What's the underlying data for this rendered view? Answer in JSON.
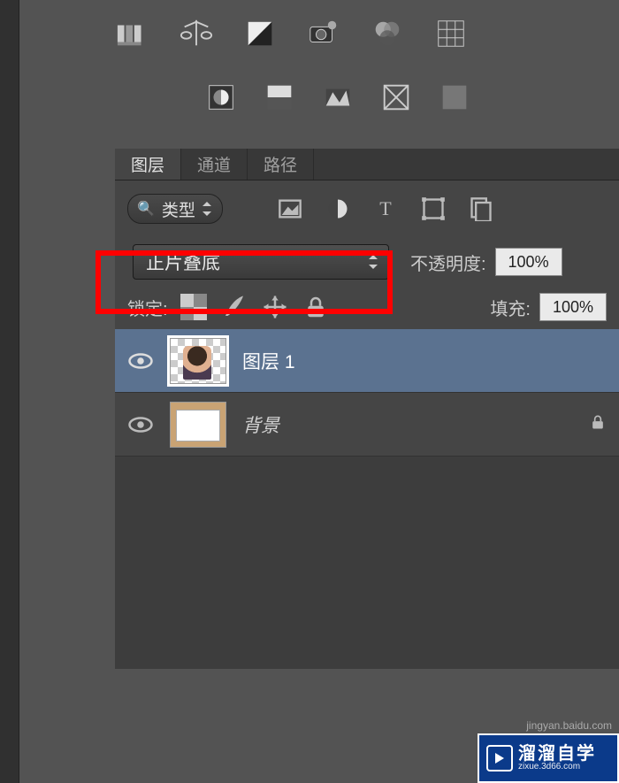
{
  "tabs": {
    "layers": "图层",
    "channels": "通道",
    "paths": "路径"
  },
  "filter": {
    "label": "类型"
  },
  "blend": {
    "mode": "正片叠底"
  },
  "opacity": {
    "label": "不透明度:",
    "value": "100%"
  },
  "lock": {
    "label": "锁定:"
  },
  "fill": {
    "label": "填充:",
    "value": "100%"
  },
  "layers_list": [
    {
      "name": "图层 1"
    },
    {
      "name": "背景"
    }
  ],
  "watermark": {
    "brand": "溜溜自学",
    "url": "zixue.3d66.com",
    "credit": "jingyan.baidu.com"
  }
}
